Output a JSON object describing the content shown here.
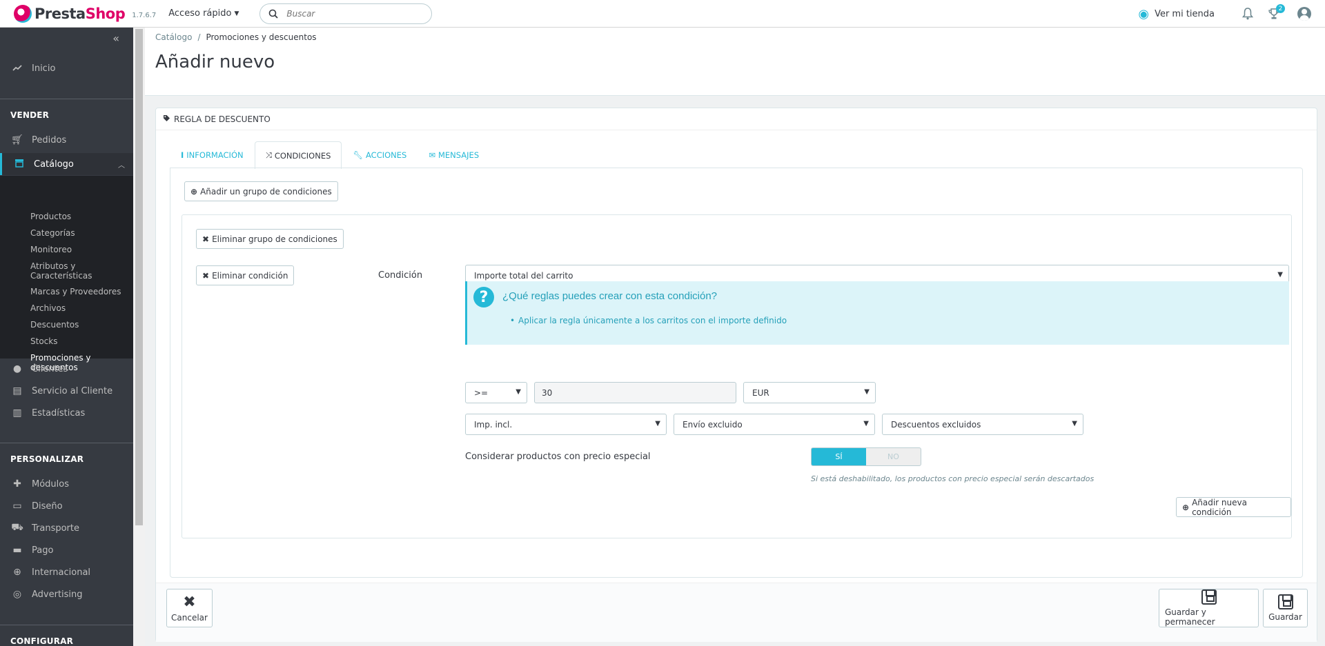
{
  "header": {
    "logo_text_a": "Presta",
    "logo_text_b": "Shop",
    "version": "1.7.6.7",
    "quick_access": "Acceso rápido",
    "search_placeholder": "Buscar",
    "view_store": "Ver mi tienda",
    "orders_badge": "2"
  },
  "sidebar": {
    "home": "Inicio",
    "section_sell": "VENDER",
    "orders": "Pedidos",
    "catalog": "Catálogo",
    "catalog_sub": [
      "Productos",
      "Categorías",
      "Monitoreo",
      "Atributos y Características",
      "Marcas y Proveedores",
      "Archivos",
      "Descuentos",
      "Stocks",
      "Promociones y descuentos"
    ],
    "customers": "Clientes",
    "customer_service": "Servicio al Cliente",
    "stats": "Estadísticas",
    "section_customize": "PERSONALIZAR",
    "modules": "Módulos",
    "design": "Diseño",
    "shipping": "Transporte",
    "payment": "Pago",
    "international": "Internacional",
    "advertising": "Advertising",
    "section_configure": "CONFIGURAR"
  },
  "page": {
    "breadcrumb_parent": "Catálogo",
    "breadcrumb_sep": "/",
    "breadcrumb_current": "Promociones y descuentos",
    "title": "Añadir nuevo"
  },
  "panel": {
    "heading": "REGLA DE DESCUENTO",
    "tabs": [
      "INFORMACIÓN",
      "CONDICIONES",
      "ACCIONES",
      "MENSAJES"
    ],
    "add_group": "Añadir un grupo de condiciones",
    "delete_group": "Eliminar grupo de condiciones",
    "delete_condition": "Eliminar condición",
    "condition_label": "Condición",
    "condition_value": "Importe total del carrito",
    "alert_title": "¿Qué reglas puedes crear con esta condición?",
    "alert_item": "Aplicar la regla únicamente a los carritos con el importe definido",
    "operator": ">=",
    "amount": "30",
    "currency": "EUR",
    "tax": "Imp. incl.",
    "shipping": "Envío excluido",
    "discounts": "Descuentos excluidos",
    "special_price_label": "Considerar productos con precio especial",
    "switch_yes": "SÍ",
    "switch_no": "NO",
    "switch_value": "SÍ",
    "hint": "Si está deshabilitado, los productos con precio especial serán descartados",
    "add_condition": "Añadir nueva condición"
  },
  "footer": {
    "cancel": "Cancelar",
    "save_stay": "Guardar y permanecer",
    "save": "Guardar"
  },
  "colors": {
    "accent": "#25b9d7",
    "sidebar": "#363a41",
    "brand_pink": "#df0067"
  }
}
